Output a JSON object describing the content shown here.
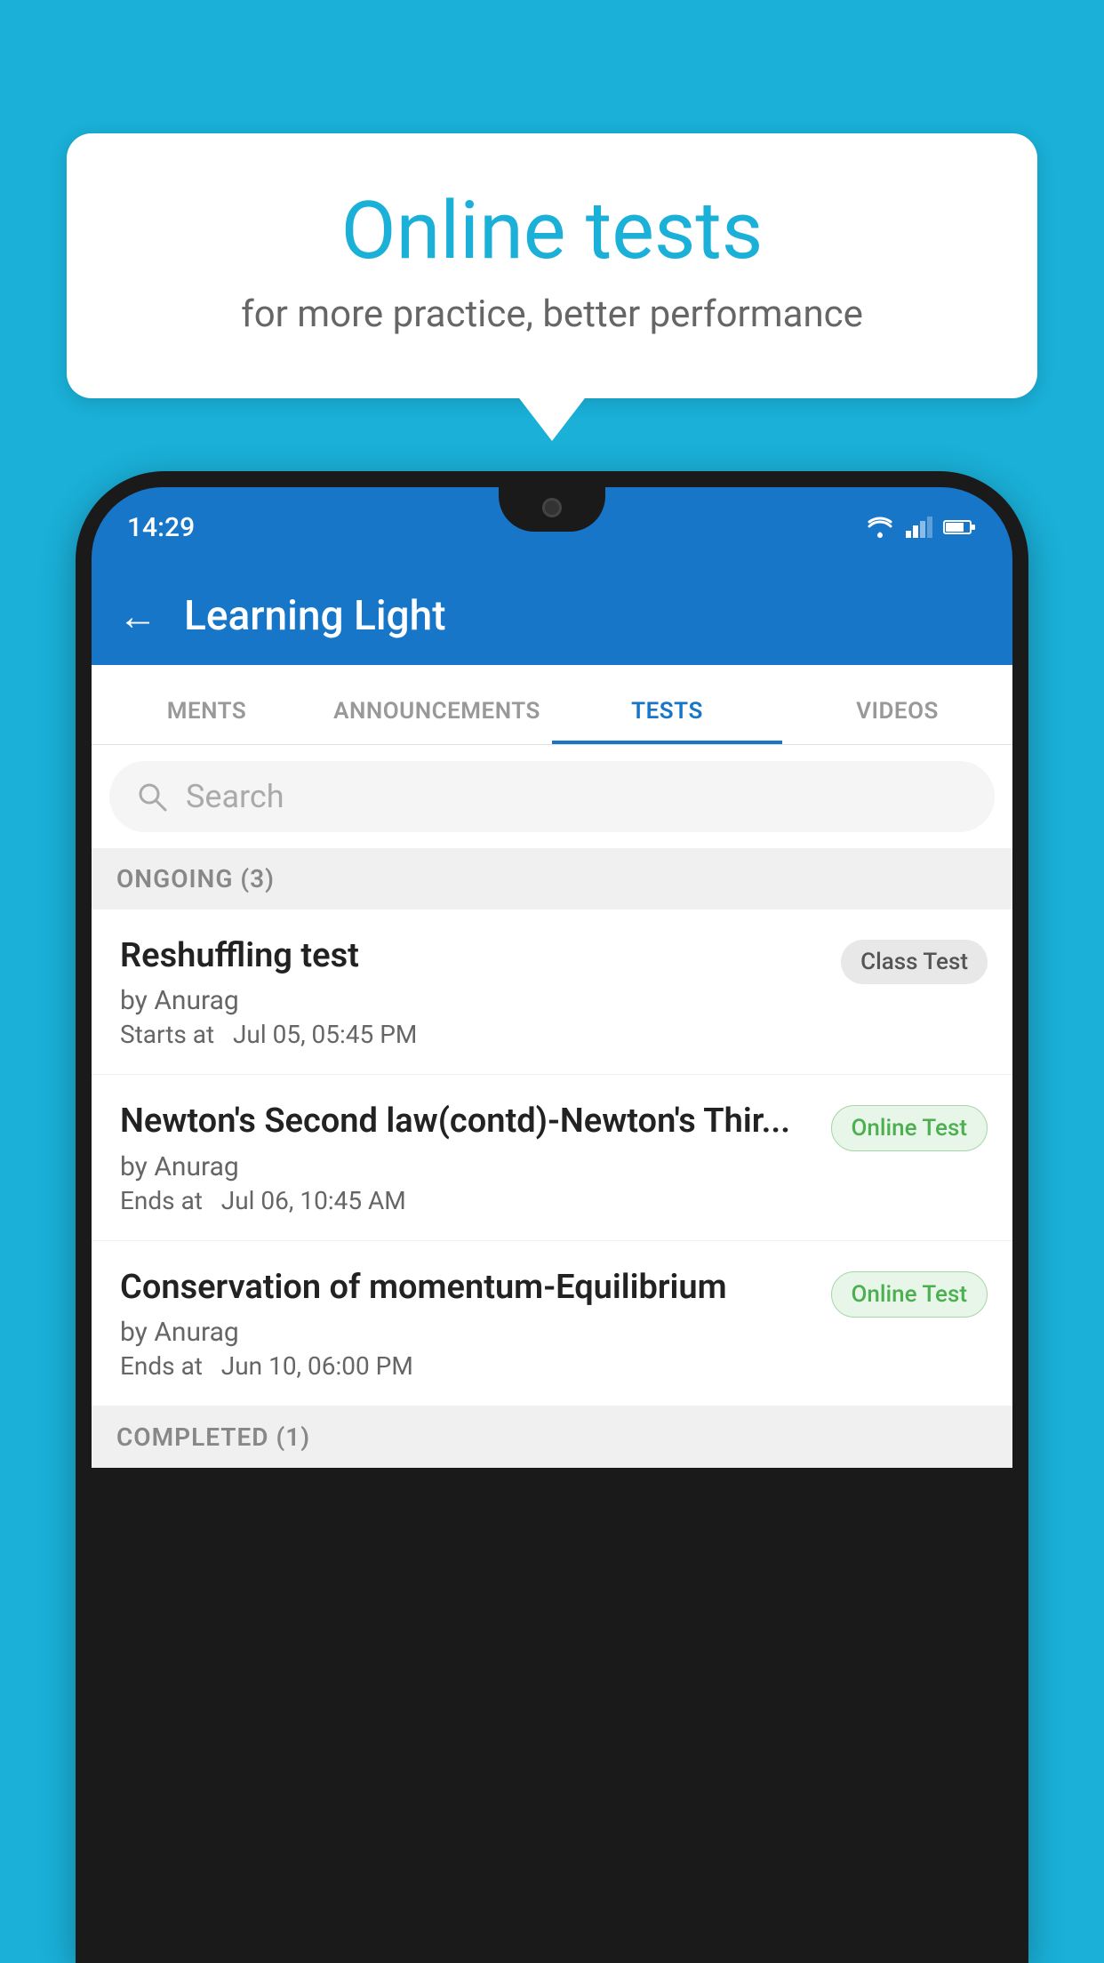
{
  "background_color": "#1ab0d8",
  "speech_bubble": {
    "title": "Online tests",
    "subtitle": "for more practice, better performance"
  },
  "phone": {
    "status_bar": {
      "time": "14:29"
    },
    "app_bar": {
      "back_label": "←",
      "title": "Learning Light"
    },
    "tabs": [
      {
        "label": "MENTS",
        "active": false
      },
      {
        "label": "ANNOUNCEMENTS",
        "active": false
      },
      {
        "label": "TESTS",
        "active": true
      },
      {
        "label": "VIDEOS",
        "active": false
      }
    ],
    "search": {
      "placeholder": "Search"
    },
    "ongoing_section": {
      "label": "ONGOING (3)"
    },
    "tests": [
      {
        "name": "Reshuffling test",
        "by": "by Anurag",
        "date": "Starts at  Jul 05, 05:45 PM",
        "badge": "Class Test",
        "badge_type": "class"
      },
      {
        "name": "Newton's Second law(contd)-Newton's Thir...",
        "by": "by Anurag",
        "date": "Ends at  Jul 06, 10:45 AM",
        "badge": "Online Test",
        "badge_type": "online"
      },
      {
        "name": "Conservation of momentum-Equilibrium",
        "by": "by Anurag",
        "date": "Ends at  Jun 10, 06:00 PM",
        "badge": "Online Test",
        "badge_type": "online"
      }
    ],
    "completed_section": {
      "label": "COMPLETED (1)"
    }
  }
}
